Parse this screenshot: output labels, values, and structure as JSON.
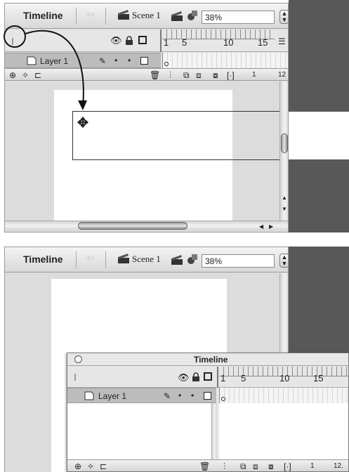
{
  "top_panel": {
    "title": "Timeline",
    "scene_label": "Scene 1",
    "zoom": "38%",
    "layer_name": "Layer 1",
    "frame_numbers": [
      "1",
      "5",
      "10",
      "15"
    ],
    "status": {
      "current_frame": "1",
      "fps": "12"
    }
  },
  "bottom_panel": {
    "title": "Timeline",
    "scene_label": "Scene 1",
    "zoom": "38%"
  },
  "floating_timeline": {
    "title": "Timeline",
    "layer_name": "Layer 1",
    "frame_numbers": [
      "1",
      "5",
      "10",
      "15"
    ],
    "status": {
      "current_frame": "1",
      "fps": "12."
    }
  }
}
